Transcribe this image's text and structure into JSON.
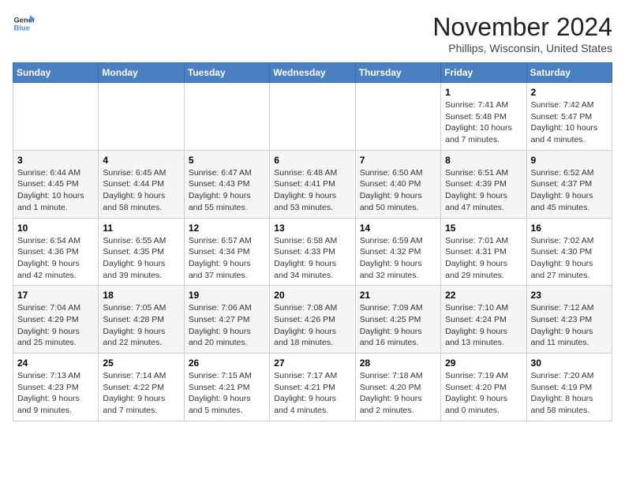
{
  "header": {
    "logo_line1": "General",
    "logo_line2": "Blue",
    "month_title": "November 2024",
    "location": "Phillips, Wisconsin, United States"
  },
  "weekdays": [
    "Sunday",
    "Monday",
    "Tuesday",
    "Wednesday",
    "Thursday",
    "Friday",
    "Saturday"
  ],
  "weeks": [
    [
      {
        "day": "",
        "info": ""
      },
      {
        "day": "",
        "info": ""
      },
      {
        "day": "",
        "info": ""
      },
      {
        "day": "",
        "info": ""
      },
      {
        "day": "",
        "info": ""
      },
      {
        "day": "1",
        "info": "Sunrise: 7:41 AM\nSunset: 5:48 PM\nDaylight: 10 hours and 7 minutes."
      },
      {
        "day": "2",
        "info": "Sunrise: 7:42 AM\nSunset: 5:47 PM\nDaylight: 10 hours and 4 minutes."
      }
    ],
    [
      {
        "day": "3",
        "info": "Sunrise: 6:44 AM\nSunset: 4:45 PM\nDaylight: 10 hours and 1 minute."
      },
      {
        "day": "4",
        "info": "Sunrise: 6:45 AM\nSunset: 4:44 PM\nDaylight: 9 hours and 58 minutes."
      },
      {
        "day": "5",
        "info": "Sunrise: 6:47 AM\nSunset: 4:43 PM\nDaylight: 9 hours and 55 minutes."
      },
      {
        "day": "6",
        "info": "Sunrise: 6:48 AM\nSunset: 4:41 PM\nDaylight: 9 hours and 53 minutes."
      },
      {
        "day": "7",
        "info": "Sunrise: 6:50 AM\nSunset: 4:40 PM\nDaylight: 9 hours and 50 minutes."
      },
      {
        "day": "8",
        "info": "Sunrise: 6:51 AM\nSunset: 4:39 PM\nDaylight: 9 hours and 47 minutes."
      },
      {
        "day": "9",
        "info": "Sunrise: 6:52 AM\nSunset: 4:37 PM\nDaylight: 9 hours and 45 minutes."
      }
    ],
    [
      {
        "day": "10",
        "info": "Sunrise: 6:54 AM\nSunset: 4:36 PM\nDaylight: 9 hours and 42 minutes."
      },
      {
        "day": "11",
        "info": "Sunrise: 6:55 AM\nSunset: 4:35 PM\nDaylight: 9 hours and 39 minutes."
      },
      {
        "day": "12",
        "info": "Sunrise: 6:57 AM\nSunset: 4:34 PM\nDaylight: 9 hours and 37 minutes."
      },
      {
        "day": "13",
        "info": "Sunrise: 6:58 AM\nSunset: 4:33 PM\nDaylight: 9 hours and 34 minutes."
      },
      {
        "day": "14",
        "info": "Sunrise: 6:59 AM\nSunset: 4:32 PM\nDaylight: 9 hours and 32 minutes."
      },
      {
        "day": "15",
        "info": "Sunrise: 7:01 AM\nSunset: 4:31 PM\nDaylight: 9 hours and 29 minutes."
      },
      {
        "day": "16",
        "info": "Sunrise: 7:02 AM\nSunset: 4:30 PM\nDaylight: 9 hours and 27 minutes."
      }
    ],
    [
      {
        "day": "17",
        "info": "Sunrise: 7:04 AM\nSunset: 4:29 PM\nDaylight: 9 hours and 25 minutes."
      },
      {
        "day": "18",
        "info": "Sunrise: 7:05 AM\nSunset: 4:28 PM\nDaylight: 9 hours and 22 minutes."
      },
      {
        "day": "19",
        "info": "Sunrise: 7:06 AM\nSunset: 4:27 PM\nDaylight: 9 hours and 20 minutes."
      },
      {
        "day": "20",
        "info": "Sunrise: 7:08 AM\nSunset: 4:26 PM\nDaylight: 9 hours and 18 minutes."
      },
      {
        "day": "21",
        "info": "Sunrise: 7:09 AM\nSunset: 4:25 PM\nDaylight: 9 hours and 16 minutes."
      },
      {
        "day": "22",
        "info": "Sunrise: 7:10 AM\nSunset: 4:24 PM\nDaylight: 9 hours and 13 minutes."
      },
      {
        "day": "23",
        "info": "Sunrise: 7:12 AM\nSunset: 4:23 PM\nDaylight: 9 hours and 11 minutes."
      }
    ],
    [
      {
        "day": "24",
        "info": "Sunrise: 7:13 AM\nSunset: 4:23 PM\nDaylight: 9 hours and 9 minutes."
      },
      {
        "day": "25",
        "info": "Sunrise: 7:14 AM\nSunset: 4:22 PM\nDaylight: 9 hours and 7 minutes."
      },
      {
        "day": "26",
        "info": "Sunrise: 7:15 AM\nSunset: 4:21 PM\nDaylight: 9 hours and 5 minutes."
      },
      {
        "day": "27",
        "info": "Sunrise: 7:17 AM\nSunset: 4:21 PM\nDaylight: 9 hours and 4 minutes."
      },
      {
        "day": "28",
        "info": "Sunrise: 7:18 AM\nSunset: 4:20 PM\nDaylight: 9 hours and 2 minutes."
      },
      {
        "day": "29",
        "info": "Sunrise: 7:19 AM\nSunset: 4:20 PM\nDaylight: 9 hours and 0 minutes."
      },
      {
        "day": "30",
        "info": "Sunrise: 7:20 AM\nSunset: 4:19 PM\nDaylight: 8 hours and 58 minutes."
      }
    ]
  ]
}
